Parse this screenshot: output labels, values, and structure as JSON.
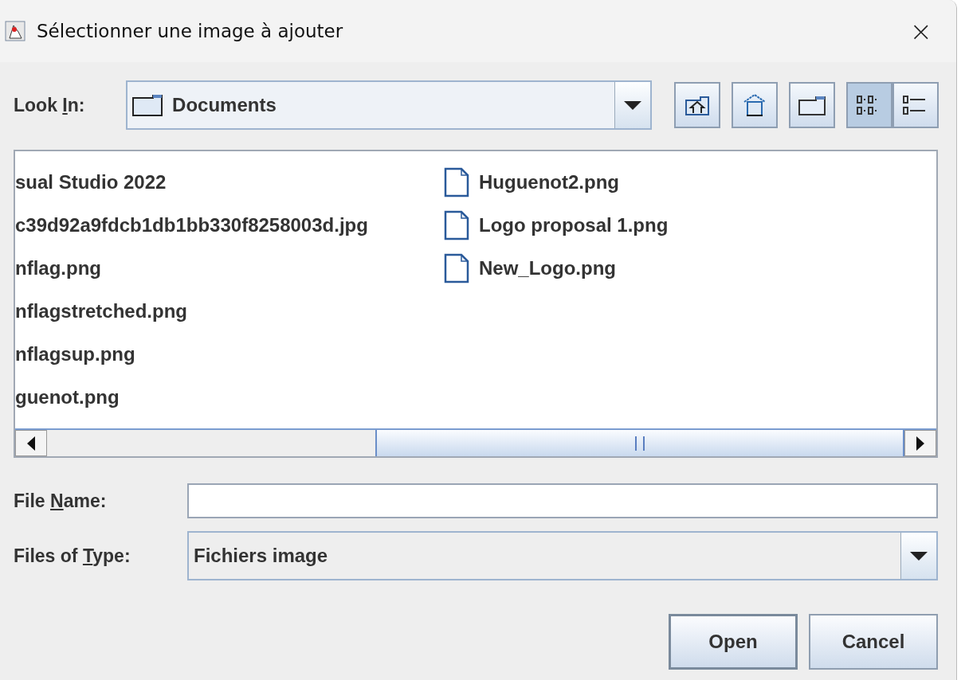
{
  "window": {
    "title": "Sélectionner une image à ajouter",
    "close": "×"
  },
  "look_in": {
    "label": "Look ",
    "mnemonic": "I",
    "label_rest": "n:",
    "value": "Documents"
  },
  "toolbar": [
    {
      "kind": "up",
      "selected": false
    },
    {
      "kind": "home",
      "selected": false
    },
    {
      "kind": "new-folder",
      "selected": false
    },
    {
      "kind": "list",
      "selected": true
    },
    {
      "kind": "details",
      "selected": false
    }
  ],
  "files": [
    {
      "name": "sual Studio 2022",
      "icon": false
    },
    {
      "name": "c39d92a9fdcb1db1bb330f8258003d.jpg",
      "icon": false
    },
    {
      "name": "nflag.png",
      "icon": false
    },
    {
      "name": "nflagstretched.png",
      "icon": false
    },
    {
      "name": "nflagsup.png",
      "icon": false
    },
    {
      "name": "guenot.png",
      "icon": false
    },
    {
      "name": "Huguenot2.png",
      "icon": true
    },
    {
      "name": "Logo proposal 1.png",
      "icon": true
    },
    {
      "name": "New_Logo.png",
      "icon": true
    }
  ],
  "file_name": {
    "label": "File ",
    "mnemonic": "N",
    "label_rest": "ame:"
  },
  "files_of_type": {
    "label": "Files of ",
    "mnemonic": "T",
    "label_rest": "ype:",
    "value": "Fichiers image"
  },
  "buttons": [
    "Open",
    "Cancel"
  ]
}
